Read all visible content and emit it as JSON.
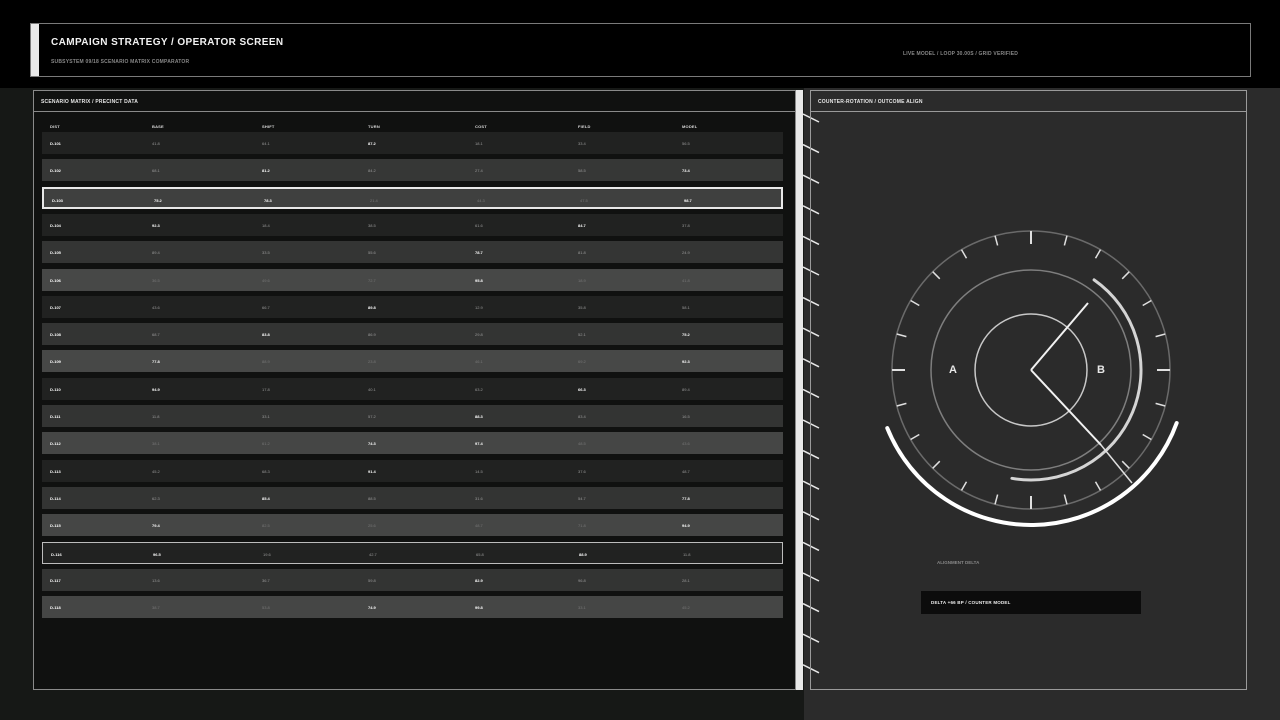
{
  "header": {
    "title": "CAMPAIGN STRATEGY / OPERATOR SCREEN",
    "subtitle": "SUBSYSTEM 09/18 SCENARIO MATRIX COMPARATOR",
    "status": "LIVE MODEL / LOOP 30.00S / GRID VERIFIED"
  },
  "matrix": {
    "title": "SCENARIO MATRIX / PRECINCT DATA",
    "columns": [
      "DIST",
      "BASE",
      "SHIFT",
      "TURN",
      "COST",
      "FIELD",
      "MODEL"
    ],
    "rows": [
      {
        "cells": [
          "D-101",
          "41.8",
          "64.1",
          "87.2",
          "18.1",
          "33.4",
          "56.5"
        ],
        "bg": "#212221",
        "bold": [
          0,
          3
        ]
      },
      {
        "cells": [
          "D-102",
          "68.1",
          "81.2",
          "84.2",
          "27.4",
          "58.5",
          "73.4"
        ],
        "bg": "#363736",
        "bold": [
          0,
          2,
          6
        ]
      },
      {
        "cells": [
          "D-103",
          "75.2",
          "78.3",
          "21.4",
          "44.3",
          "47.5",
          "98.7"
        ],
        "bg": "#3f403f",
        "bold": [
          0,
          1,
          2,
          6
        ],
        "selected": true
      },
      {
        "cells": [
          "D-104",
          "92.3",
          "18.4",
          "38.5",
          "61.6",
          "84.7",
          "37.8"
        ],
        "bg": "#212221",
        "bold": [
          0,
          1,
          5
        ]
      },
      {
        "cells": [
          "D-105",
          "89.4",
          "33.5",
          "55.6",
          "78.7",
          "81.8",
          "24.9"
        ],
        "bg": "#343534",
        "bold": [
          0,
          4
        ]
      },
      {
        "cells": [
          "D-106",
          "36.5",
          "49.6",
          "72.7",
          "95.8",
          "18.9",
          "41.8"
        ],
        "bg": "#474847",
        "bold": [
          0,
          4
        ]
      },
      {
        "cells": [
          "D-107",
          "43.6",
          "66.7",
          "89.8",
          "12.9",
          "35.8",
          "58.1"
        ],
        "bg": "#212221",
        "bold": [
          0,
          3
        ]
      },
      {
        "cells": [
          "D-108",
          "68.7",
          "83.8",
          "86.9",
          "29.8",
          "52.1",
          "75.2"
        ],
        "bg": "#333433",
        "bold": [
          0,
          2,
          6
        ]
      },
      {
        "cells": [
          "D-109",
          "77.8",
          "88.9",
          "23.8",
          "46.1",
          "69.2",
          "92.3"
        ],
        "bg": "#474847",
        "bold": [
          0,
          1,
          6
        ]
      },
      {
        "cells": [
          "D-110",
          "94.9",
          "17.8",
          "40.1",
          "63.2",
          "66.3",
          "89.4"
        ],
        "bg": "#212221",
        "bold": [
          0,
          1,
          5
        ]
      },
      {
        "cells": [
          "D-111",
          "11.8",
          "33.1",
          "57.2",
          "88.3",
          "83.4",
          "16.5"
        ],
        "bg": "#333433",
        "bold": [
          0,
          4
        ]
      },
      {
        "cells": [
          "D-112",
          "38.1",
          "61.2",
          "74.3",
          "97.4",
          "48.5",
          "43.6"
        ],
        "bg": "#454645",
        "bold": [
          0,
          3,
          4
        ]
      },
      {
        "cells": [
          "D-113",
          "45.2",
          "68.3",
          "91.4",
          "14.5",
          "37.6",
          "48.7"
        ],
        "bg": "#212221",
        "bold": [
          0,
          3
        ]
      },
      {
        "cells": [
          "D-114",
          "62.3",
          "85.4",
          "88.5",
          "31.6",
          "54.7",
          "77.8"
        ],
        "bg": "#333433",
        "bold": [
          0,
          2,
          6
        ]
      },
      {
        "cells": [
          "D-115",
          "79.4",
          "82.5",
          "25.6",
          "48.7",
          "71.8",
          "94.9"
        ],
        "bg": "#454645",
        "bold": [
          0,
          1,
          6
        ]
      },
      {
        "cells": [
          "D-116",
          "96.5",
          "19.6",
          "42.7",
          "65.8",
          "88.9",
          "11.8"
        ],
        "bg": "#212221",
        "bold": [
          0,
          1,
          5
        ],
        "outlined": true
      },
      {
        "cells": [
          "D-117",
          "13.6",
          "36.7",
          "59.8",
          "82.9",
          "96.8",
          "28.1"
        ],
        "bg": "#333433",
        "bold": [
          0,
          4
        ]
      },
      {
        "cells": [
          "D-118",
          "38.7",
          "53.8",
          "74.9",
          "99.8",
          "33.1",
          "45.2"
        ],
        "bg": "#454645",
        "bold": [
          0,
          3,
          4
        ]
      }
    ]
  },
  "dial": {
    "title": "COUNTER-ROTATION / OUTCOME ALIGN",
    "label_a": "A",
    "label_b": "B",
    "alignment_label": "ALIGNMENT DELTA",
    "delta_text": "DELTA +66 BP / COUNTER MODEL"
  },
  "colors": {
    "accent": "#e8e8e8",
    "panel_left": "#161816",
    "panel_right": "#2b2b2b"
  }
}
